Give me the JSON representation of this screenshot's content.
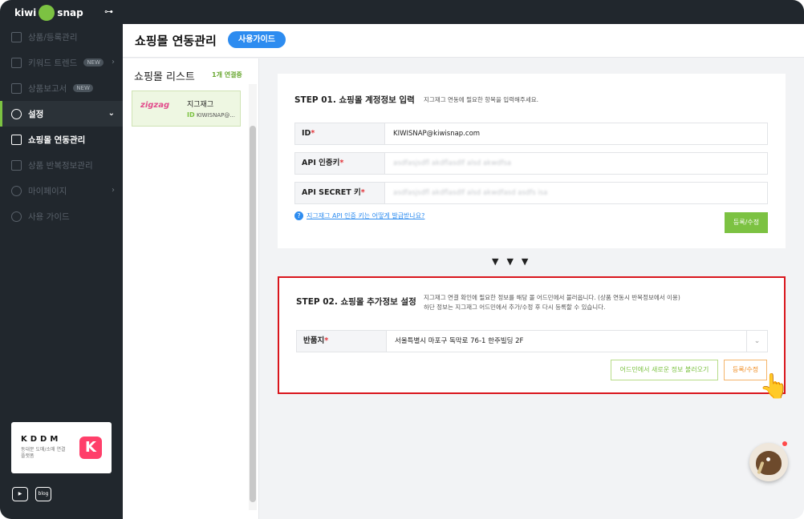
{
  "brand": {
    "left": "kiwi",
    "right": "snap"
  },
  "sidebar": {
    "items": [
      {
        "label": "상품/등록관리",
        "icon": "list-icon"
      },
      {
        "label": "키워드 트렌드",
        "icon": "chart-icon",
        "badge": "NEW"
      },
      {
        "label": "상품보고서",
        "icon": "report-icon",
        "badge": "NEW"
      },
      {
        "label": "설정",
        "icon": "gear-icon"
      },
      {
        "label": "쇼핑몰 연동관리",
        "icon": "store-icon"
      },
      {
        "label": "상품 반복정보관리",
        "icon": "store-icon"
      },
      {
        "label": "마이페이지",
        "icon": "user-icon"
      },
      {
        "label": "사용 가이드",
        "icon": "help-icon"
      }
    ],
    "promo": {
      "title": "KDDM",
      "subtitle": "동대문 도매/소매 연결 플랫폼",
      "logo": "K"
    },
    "social": {
      "youtube": "▶",
      "blog": "blog"
    }
  },
  "header": {
    "title": "쇼핑몰 연동관리",
    "guide_button": "사용가이드"
  },
  "shop_list": {
    "title": "쇼핑몰 리스트",
    "count": "1개 연결중",
    "items": [
      {
        "logo": "zigzag",
        "name": "지그재그",
        "id_label": "ID",
        "id_value": "KIWISNAP@..."
      }
    ]
  },
  "step1": {
    "title": "STEP 01. 쇼핑몰 계정정보 입력",
    "desc": "지그재그 연동에 필요한 항목을 입력해주세요.",
    "fields": [
      {
        "label": "ID",
        "value": "KIWISNAP@kiwisnap.com"
      },
      {
        "label": "API 인증키",
        "value": "asdfasjsdfl akdflasdlf alsd akwdfsa"
      },
      {
        "label": "API SECRET 키",
        "value": "asdfasjsdfl akdflasdlf alsd akwdfasd asdfs isa"
      }
    ],
    "help_text": "지그재그 API 인증 키는 어떻게 발급받나요?",
    "submit": "등록/수정"
  },
  "arrows": "▼▼▼",
  "step2": {
    "title": "STEP 02. 쇼핑몰 추가정보 설정",
    "desc1": "지그재그 연결 확인에 필요한 정보를 해당 몰 어드민에서 불러옵니다. (상품 연동시 반복정보에서 이용)",
    "desc2": "하단 정보는 지그재그 어드민에서 추가/수정 후 다시 등록할 수 있습니다.",
    "field": {
      "label": "반품지",
      "value": "서울특별시 마포구 독막로 76-1 한주빌딩 2F"
    },
    "load_button": "어드민에서 새로운 정보 불러오기",
    "submit": "등록/수정"
  },
  "colors": {
    "accent": "#7cc242",
    "blue": "#2d8cf0",
    "highlight": "#d9151c"
  }
}
